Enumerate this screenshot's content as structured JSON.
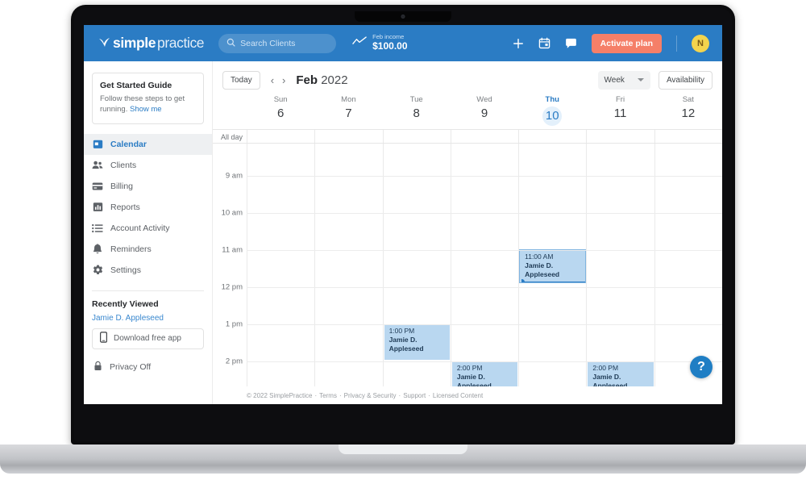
{
  "topbar": {
    "brand_mark": "❯",
    "brand_bold": "simple",
    "brand_light": "practice",
    "search_placeholder": "Search Clients",
    "income_label": "Feb income",
    "income_value": "$100.00",
    "plus_icon": "plus-icon",
    "calendar_icon": "calendar-icon",
    "chat_icon": "chat-icon",
    "activate_label": "Activate plan",
    "avatar_initial": "N",
    "accent_blue": "#2b7cc4",
    "accent_coral": "#f57f68",
    "avatar_color": "#f4d44d"
  },
  "sidebar": {
    "guide": {
      "title": "Get Started Guide",
      "text": "Follow these steps to get running.",
      "link": "Show me"
    },
    "nav": [
      {
        "label": "Calendar",
        "icon": "calendar-icon",
        "active": true
      },
      {
        "label": "Clients",
        "icon": "people-icon",
        "active": false
      },
      {
        "label": "Billing",
        "icon": "card-icon",
        "active": false
      },
      {
        "label": "Reports",
        "icon": "bar-chart-icon",
        "active": false
      },
      {
        "label": "Account Activity",
        "icon": "list-icon",
        "active": false
      },
      {
        "label": "Reminders",
        "icon": "bell-icon",
        "active": false
      },
      {
        "label": "Settings",
        "icon": "gear-icon",
        "active": false
      }
    ],
    "recently_viewed_title": "Recently Viewed",
    "recent_client": "Jamie D. Appleseed",
    "download_app": "Download free app",
    "privacy": "Privacy Off"
  },
  "calendar": {
    "today_button": "Today",
    "prev_arrow": "‹",
    "next_arrow": "›",
    "month": "Feb",
    "year": "2022",
    "view_select": "Week",
    "availability_button": "Availability",
    "all_day_label": "All day",
    "days": [
      {
        "name": "Sun",
        "num": "6",
        "today": false
      },
      {
        "name": "Mon",
        "num": "7",
        "today": false
      },
      {
        "name": "Tue",
        "num": "8",
        "today": false
      },
      {
        "name": "Wed",
        "num": "9",
        "today": false
      },
      {
        "name": "Thu",
        "num": "10",
        "today": true
      },
      {
        "name": "Fri",
        "num": "11",
        "today": false
      },
      {
        "name": "Sat",
        "num": "12",
        "today": false
      }
    ],
    "times": [
      "9 am",
      "10 am",
      "11 am",
      "12 pm",
      "1 pm",
      "2 pm"
    ],
    "events": [
      {
        "time": "11:00 AM",
        "client": "Jamie D. Appleseed",
        "day": 4,
        "start_hour": "11 am",
        "selected": true
      },
      {
        "time": "1:00 PM",
        "client": "Jamie D. Appleseed",
        "day": 2,
        "start_hour": "1 pm",
        "selected": false
      },
      {
        "time": "2:00 PM",
        "client": "Jamie D. Appleseed",
        "day": 3,
        "start_hour": "2 pm",
        "selected": false
      },
      {
        "time": "2:00 PM",
        "client": "Jamie D. Appleseed",
        "day": 5,
        "start_hour": "2 pm",
        "selected": false
      }
    ],
    "help_label": "?"
  },
  "footer": {
    "copyright": "© 2022 SimplePractice",
    "links": [
      "Terms",
      "Privacy & Security",
      "Support",
      "Licensed Content"
    ],
    "separator": "·"
  }
}
